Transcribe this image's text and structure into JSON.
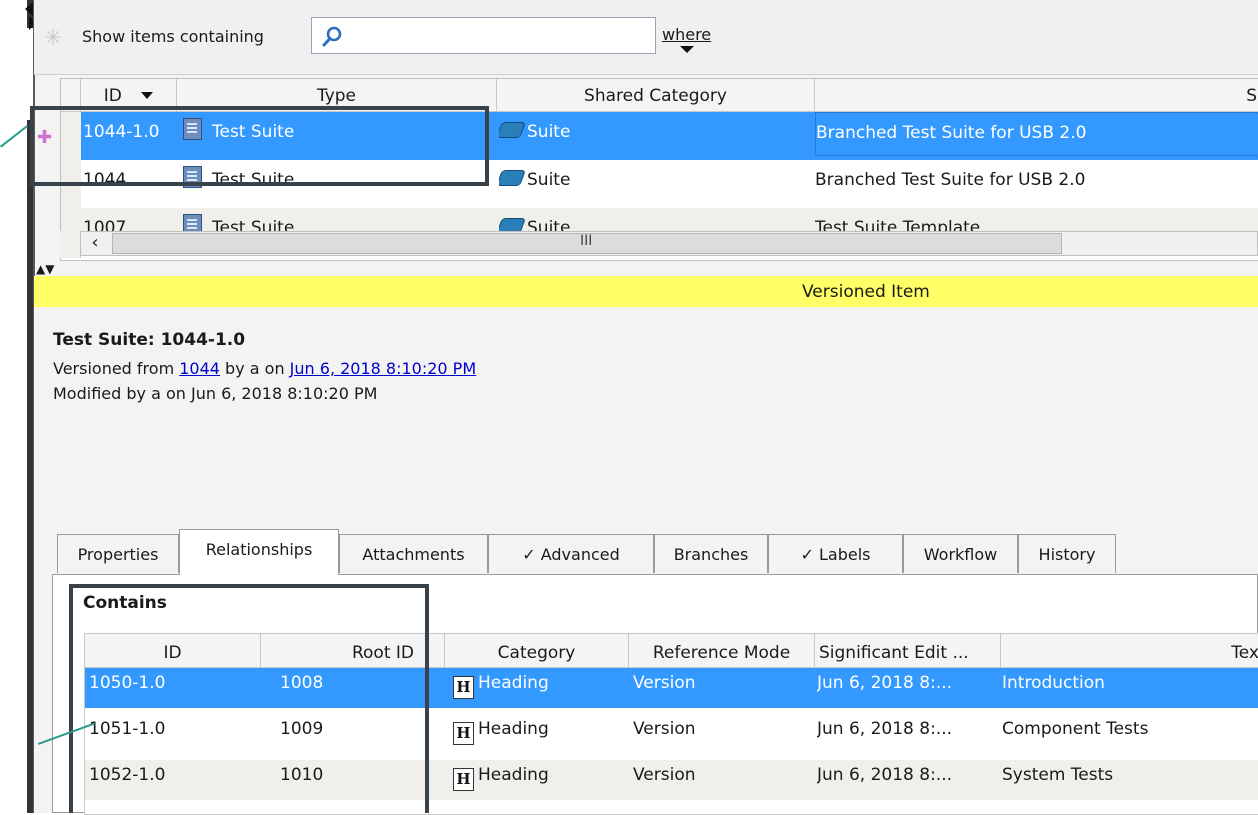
{
  "toolbar": {
    "show_label": "Show items containing",
    "search_value": "",
    "where_label": "where"
  },
  "grid": {
    "columns": [
      "ID",
      "Type",
      "Shared Category",
      "S"
    ],
    "rows": [
      {
        "id": "1044-1.0",
        "type": "Test Suite",
        "category": "Suite",
        "summary": "Branched Test Suite for USB 2.0",
        "selected": true
      },
      {
        "id": "1044",
        "type": "Test Suite",
        "category": "Suite",
        "summary": "Branched Test Suite for USB 2.0",
        "selected": false
      },
      {
        "id": "1007",
        "type": "Test Suite",
        "category": "Suite",
        "summary": "Test Suite Template",
        "selected": false
      }
    ],
    "scroll_grip": "III"
  },
  "banner": {
    "text": "Versioned Item"
  },
  "detail": {
    "title": "Test Suite:  1044-1.0",
    "versioned_prefix": "Versioned from ",
    "versioned_link": "1044",
    "versioned_mid": " by a on ",
    "versioned_date": "Jun 6, 2018 8:10:20 PM",
    "modified": "Modified by a on Jun 6, 2018 8:10:20 PM"
  },
  "tabs": [
    {
      "label": "Properties"
    },
    {
      "label": "Relationships",
      "active": true
    },
    {
      "label": "Attachments"
    },
    {
      "label": "✓  Advanced"
    },
    {
      "label": "Branches"
    },
    {
      "label": "✓  Labels"
    },
    {
      "label": "Workflow"
    },
    {
      "label": "History"
    }
  ],
  "contains": {
    "label": "Contains",
    "columns": [
      "ID",
      "Root ID",
      "Category",
      "Reference Mode",
      "Significant Edit ...",
      "Tex"
    ],
    "rows": [
      {
        "id": "1050-1.0",
        "root": "1008",
        "category": "Heading",
        "mode": "Version",
        "edit": "Jun 6, 2018 8:...",
        "text": "Introduction"
      },
      {
        "id": "1051-1.0",
        "root": "1009",
        "category": "Heading",
        "mode": "Version",
        "edit": "Jun 6, 2018 8:...",
        "text": "Component Tests"
      },
      {
        "id": "1052-1.0",
        "root": "1010",
        "category": "Heading",
        "mode": "Version",
        "edit": "Jun 6, 2018 8:...",
        "text": "System Tests"
      }
    ]
  }
}
